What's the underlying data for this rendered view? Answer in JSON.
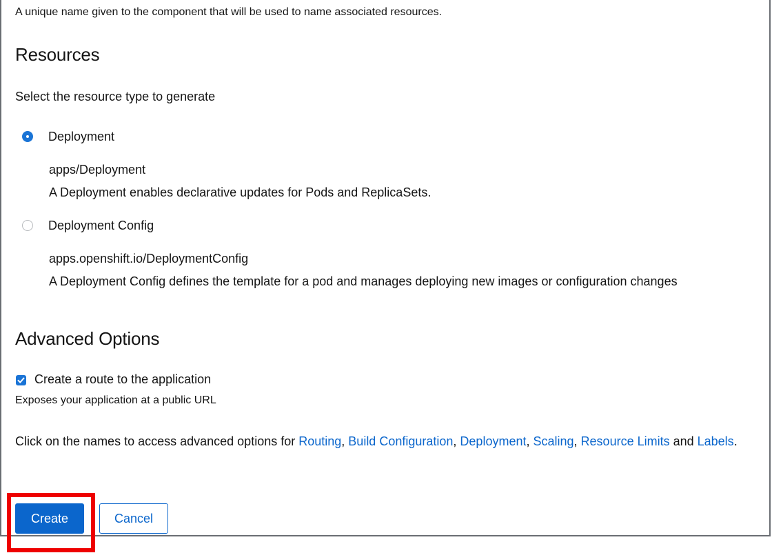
{
  "form": {
    "name_helper": "A unique name given to the component that will be used to name associated resources.",
    "resources": {
      "title": "Resources",
      "subtitle": "Select the resource type to generate",
      "options": [
        {
          "label": "Deployment",
          "api": "apps/Deployment",
          "description": "A Deployment enables declarative updates for Pods and ReplicaSets.",
          "selected": true
        },
        {
          "label": "Deployment Config",
          "api": "apps.openshift.io/DeploymentConfig",
          "description": "A Deployment Config defines the template for a pod and manages deploying new images or configuration changes",
          "selected": false
        }
      ]
    },
    "advanced": {
      "title": "Advanced Options",
      "route_checkbox": {
        "label": "Create a route to the application",
        "helper": "Exposes your application at a public URL",
        "checked": true
      },
      "text_prefix": "Click on the names to access advanced options for ",
      "links": [
        "Routing",
        "Build Configuration",
        "Deployment",
        "Scaling",
        "Resource Limits",
        "Labels"
      ],
      "sep": ", ",
      "and_text": " and ",
      "suffix": "."
    },
    "actions": {
      "create_label": "Create",
      "cancel_label": "Cancel"
    }
  },
  "colors": {
    "primary": "#0b66cc",
    "highlight": "#ee0000",
    "checked": "#1a74d6"
  }
}
